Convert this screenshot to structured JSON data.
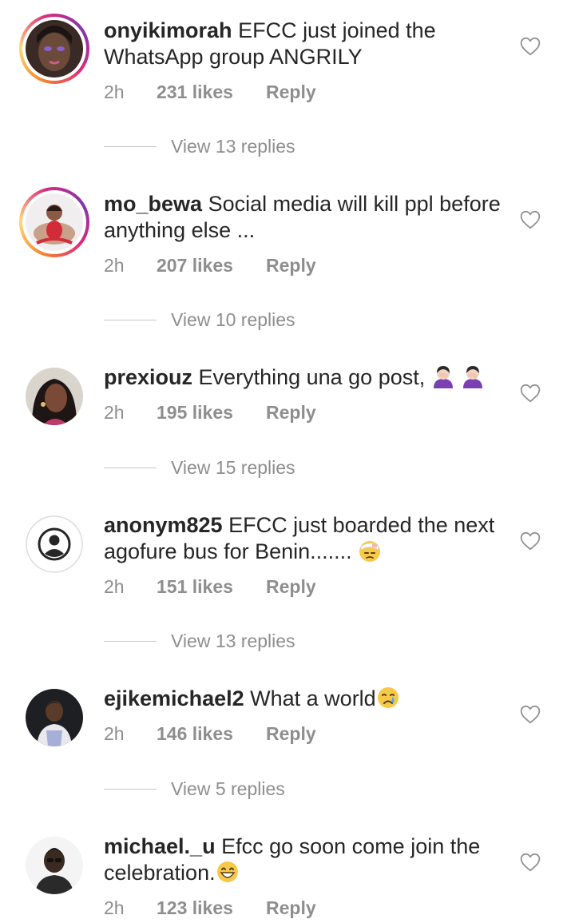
{
  "comments": [
    {
      "username": "onyikimorah",
      "text": "EFCC just joined the WhatsApp group ANGRILY",
      "time": "2h",
      "likes": "231 likes",
      "reply": "Reply",
      "view_replies": "View 13 replies",
      "avatar_type": "story"
    },
    {
      "username": "mo_bewa",
      "text": "Social media will kill ppl before anything else ...",
      "time": "2h",
      "likes": "207 likes",
      "reply": "Reply",
      "view_replies": "View 10 replies",
      "avatar_type": "story"
    },
    {
      "username": "prexiouz",
      "text": "Everything una go post,",
      "emoji": "person-facepalming-emoji x2",
      "time": "2h",
      "likes": "195 likes",
      "reply": "Reply",
      "view_replies": "View 15 replies",
      "avatar_type": "plain"
    },
    {
      "username": "anonym825",
      "text": "EFCC just boarded the next agofure bus for Benin.......",
      "emoji": "head-bandage-emoji",
      "time": "2h",
      "likes": "151 likes",
      "reply": "Reply",
      "view_replies": "View 13 replies",
      "avatar_type": "default"
    },
    {
      "username": "ejikemichael2",
      "text": "What a world",
      "emoji": "crying-face-emoji",
      "time": "2h",
      "likes": "146 likes",
      "reply": "Reply",
      "view_replies": "View 5 replies",
      "avatar_type": "plain"
    },
    {
      "username": "michael._u",
      "text": "Efcc go soon come join the celebration.",
      "emoji": "grinning-face-emoji",
      "time": "2h",
      "likes": "123 likes",
      "reply": "Reply",
      "avatar_type": "plain"
    }
  ],
  "colors": {
    "text": "#262626",
    "muted": "#8e8e8e",
    "divider": "#c7c7c7",
    "story_ring": [
      "#f58529",
      "#dd2a7b",
      "#8134af"
    ]
  }
}
